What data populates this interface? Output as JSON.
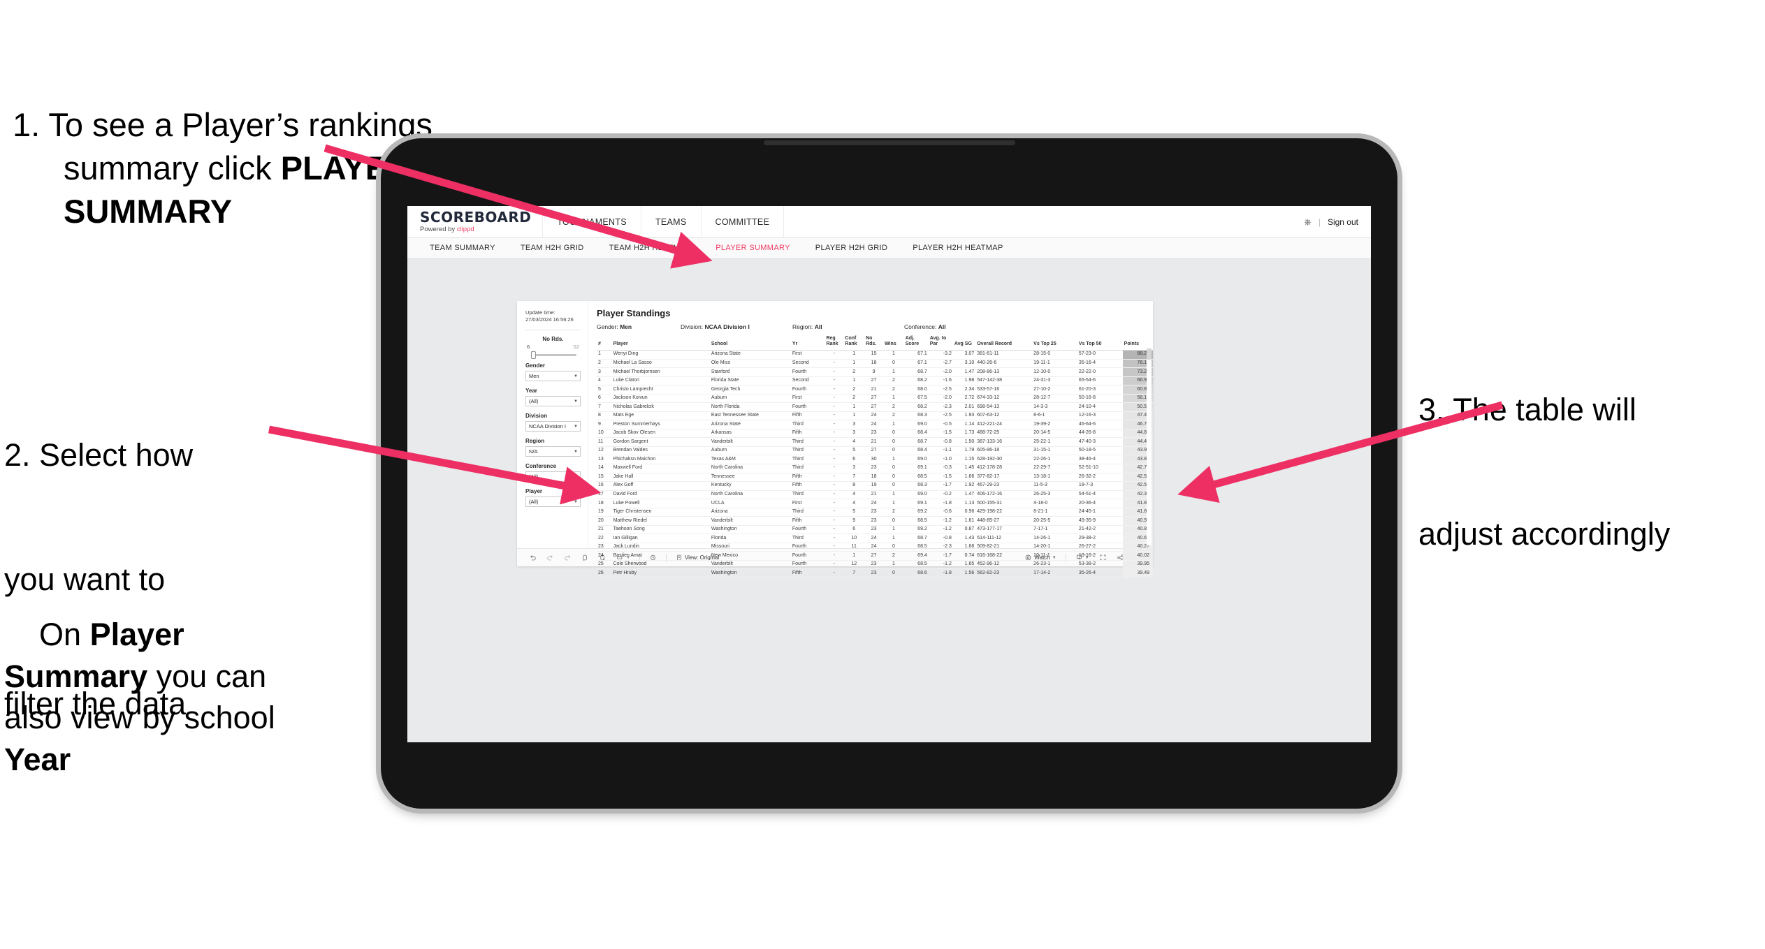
{
  "annotations": {
    "step1_prefix": "1.",
    "step1_part1": " To see a Player’s rankings summary click ",
    "step1_bold": "PLAYER SUMMARY",
    "step2_line1": "2. Select how",
    "step2_line2": "you want to",
    "step2_line3": "filter the data",
    "step2b_pre": "On ",
    "step2b_bold1": "Player Summary",
    "step2b_mid": " you can also view by school ",
    "step2b_bold2": "Year",
    "step3_line1": "3. The table will",
    "step3_line2": "adjust accordingly"
  },
  "app": {
    "brand_name": "SCOREBOARD",
    "brand_sub_prefix": "Powered by ",
    "brand_sub_accent": "clippd",
    "accent_color": "#ee3b63",
    "top_nav": [
      "TOURNAMENTS",
      "TEAMS",
      "COMMITTEE"
    ],
    "account_icon": "person-icon",
    "divider": "|",
    "sign_out": "Sign out"
  },
  "tabs": [
    {
      "label": "TEAM SUMMARY",
      "active": false
    },
    {
      "label": "TEAM H2H GRID",
      "active": false
    },
    {
      "label": "TEAM H2H HEATMAP",
      "active": false
    },
    {
      "label": "PLAYER SUMMARY",
      "active": true
    },
    {
      "label": "PLAYER H2H GRID",
      "active": false
    },
    {
      "label": "PLAYER H2H HEATMAP",
      "active": false
    }
  ],
  "filters": {
    "update_label": "Update time:",
    "update_value": "27/03/2024 16:56:26",
    "slider": {
      "title": "No Rds.",
      "min": "6",
      "max": "52"
    },
    "selects": [
      {
        "label": "Gender",
        "value": "Men"
      },
      {
        "label": "Year",
        "value": "(All)"
      },
      {
        "label": "Division",
        "value": "NCAA Division I"
      },
      {
        "label": "Region",
        "value": "N/A"
      },
      {
        "label": "Conference",
        "value": "(All)"
      },
      {
        "label": "Player",
        "value": "(All)"
      }
    ]
  },
  "viz": {
    "title": "Player Standings",
    "subtitle": [
      {
        "label": "Gender:",
        "value": "Men"
      },
      {
        "label": "Division:",
        "value": "NCAA Division I"
      },
      {
        "label": "Region:",
        "value": "All"
      },
      {
        "label": "Conference:",
        "value": "All"
      }
    ],
    "columns": [
      "#",
      "Player",
      "School",
      "Yr",
      "Reg Rank",
      "Conf Rank",
      "No Rds.",
      "Wins",
      "Adj. Score",
      "Avg. to Par",
      "Avg SG",
      "Overall Record",
      "Vs Top 25",
      "Vs Top 50",
      "Points"
    ],
    "rows": [
      [
        "1",
        "Wenyi Ding",
        "Arizona State",
        "First",
        "-",
        "1",
        "15",
        "1",
        "67.1",
        "-3.2",
        "3.07",
        "381-61-11",
        "28-15-0",
        "57-23-0",
        "88.22"
      ],
      [
        "2",
        "Michael La Sasso",
        "Ole Miss",
        "Second",
        "-",
        "1",
        "18",
        "0",
        "67.1",
        "-2.7",
        "3.10",
        "440-26-6",
        "19-11-1",
        "35-16-4",
        "76.12"
      ],
      [
        "3",
        "Michael Thorbjornsen",
        "Stanford",
        "Fourth",
        "-",
        "2",
        "9",
        "1",
        "68.7",
        "-2.0",
        "1.47",
        "208-86-13",
        "12-10-0",
        "22-22-0",
        "73.22"
      ],
      [
        "4",
        "Luke Claton",
        "Florida State",
        "Second",
        "-",
        "1",
        "27",
        "2",
        "68.2",
        "-1.6",
        "1.98",
        "547-142-38",
        "24-31-3",
        "65-54-6",
        "66.94"
      ],
      [
        "5",
        "Christo Lamprecht",
        "Georgia Tech",
        "Fourth",
        "-",
        "2",
        "21",
        "2",
        "68.0",
        "-2.5",
        "2.34",
        "533-57-16",
        "27-10-2",
        "61-20-3",
        "60.89"
      ],
      [
        "6",
        "Jackson Koivun",
        "Auburn",
        "First",
        "-",
        "2",
        "27",
        "1",
        "67.5",
        "-2.0",
        "2.72",
        "674-33-12",
        "28-12-7",
        "50-16-8",
        "58.18"
      ],
      [
        "7",
        "Nicholas Gabrelcik",
        "North Florida",
        "Fourth",
        "-",
        "1",
        "27",
        "2",
        "68.2",
        "-2.3",
        "2.01",
        "698-54-13",
        "14-3-3",
        "24-10-4",
        "50.56"
      ],
      [
        "8",
        "Mats Ege",
        "East Tennessee State",
        "Fifth",
        "-",
        "1",
        "24",
        "2",
        "68.3",
        "-2.5",
        "1.93",
        "607-63-12",
        "8-6-1",
        "12-16-3",
        "47.42"
      ],
      [
        "9",
        "Preston Summerhays",
        "Arizona State",
        "Third",
        "-",
        "3",
        "24",
        "1",
        "69.0",
        "-0.5",
        "1.14",
        "412-221-24",
        "19-39-2",
        "46-64-6",
        "46.77"
      ],
      [
        "10",
        "Jacob Skov Olesen",
        "Arkansas",
        "Fifth",
        "-",
        "3",
        "23",
        "0",
        "68.4",
        "-1.5",
        "1.73",
        "488-72-25",
        "20-14-5",
        "44-26-8",
        "44.82"
      ],
      [
        "11",
        "Gordon Sargent",
        "Vanderbilt",
        "Third",
        "-",
        "4",
        "21",
        "0",
        "68.7",
        "-0.8",
        "1.50",
        "387-133-16",
        "25-22-1",
        "47-40-3",
        "44.49"
      ],
      [
        "12",
        "Brendan Valdes",
        "Auburn",
        "Third",
        "-",
        "5",
        "27",
        "0",
        "68.4",
        "-1.1",
        "1.79",
        "605-96-18",
        "31-15-1",
        "50-18-5",
        "43.95"
      ],
      [
        "13",
        "Phichaksn Maichon",
        "Texas A&M",
        "Third",
        "-",
        "6",
        "30",
        "1",
        "69.0",
        "-1.0",
        "1.15",
        "628-192-30",
        "22-26-1",
        "38-46-4",
        "43.83"
      ],
      [
        "14",
        "Maxwell Ford",
        "North Carolina",
        "Third",
        "-",
        "3",
        "23",
        "0",
        "69.1",
        "-0.3",
        "1.45",
        "412-178-28",
        "22-29-7",
        "52-51-10",
        "42.75"
      ],
      [
        "15",
        "Jake Hall",
        "Tennessee",
        "Fifth",
        "-",
        "7",
        "18",
        "0",
        "68.5",
        "-1.5",
        "1.66",
        "377-82-17",
        "13-18-1",
        "26-32-2",
        "42.55"
      ],
      [
        "16",
        "Alex Goff",
        "Kentucky",
        "Fifth",
        "-",
        "8",
        "19",
        "0",
        "68.3",
        "-1.7",
        "1.92",
        "467-29-23",
        "11-5-3",
        "18-7-3",
        "42.54"
      ],
      [
        "17",
        "David Ford",
        "North Carolina",
        "Third",
        "-",
        "4",
        "21",
        "1",
        "69.0",
        "-0.2",
        "1.47",
        "406-172-16",
        "26-25-3",
        "54-51-4",
        "42.35"
      ],
      [
        "18",
        "Luke Powell",
        "UCLA",
        "First",
        "-",
        "4",
        "24",
        "1",
        "69.1",
        "-1.8",
        "1.13",
        "500-155-31",
        "4-18-0",
        "20-36-4",
        "41.87"
      ],
      [
        "19",
        "Tiger Christensen",
        "Arizona",
        "Third",
        "-",
        "5",
        "23",
        "2",
        "69.2",
        "-0.6",
        "0.96",
        "429-198-22",
        "8-21-1",
        "24-45-1",
        "41.81"
      ],
      [
        "20",
        "Matthew Riedel",
        "Vanderbilt",
        "Fifth",
        "-",
        "9",
        "23",
        "0",
        "68.5",
        "-1.2",
        "1.61",
        "448-85-27",
        "20-25-5",
        "49-35-9",
        "40.98"
      ],
      [
        "21",
        "Taehoon Song",
        "Washington",
        "Fourth",
        "-",
        "6",
        "23",
        "1",
        "69.2",
        "-1.2",
        "0.87",
        "473-177-17",
        "7-17-1",
        "21-42-2",
        "40.88"
      ],
      [
        "22",
        "Ian Gilligan",
        "Florida",
        "Third",
        "-",
        "10",
        "24",
        "1",
        "68.7",
        "-0.8",
        "1.43",
        "514-111-12",
        "14-26-1",
        "29-38-2",
        "40.68"
      ],
      [
        "23",
        "Jack Lundin",
        "Missouri",
        "Fourth",
        "-",
        "11",
        "24",
        "0",
        "68.5",
        "-2.3",
        "1.68",
        "509-82-21",
        "14-20-1",
        "26-27-2",
        "40.27"
      ],
      [
        "24",
        "Bastien Amat",
        "New Mexico",
        "Fourth",
        "-",
        "1",
        "27",
        "2",
        "69.4",
        "-1.7",
        "0.74",
        "616-168-22",
        "10-11-1",
        "19-16-2",
        "40.02"
      ],
      [
        "25",
        "Cole Sherwood",
        "Vanderbilt",
        "Fourth",
        "-",
        "12",
        "23",
        "1",
        "68.5",
        "-1.2",
        "1.65",
        "452-96-12",
        "26-23-1",
        "53-38-2",
        "39.95"
      ],
      [
        "26",
        "Petr Hruby",
        "Washington",
        "Fifth",
        "-",
        "7",
        "23",
        "0",
        "68.6",
        "-1.8",
        "1.56",
        "562-82-23",
        "17-14-2",
        "35-26-4",
        "39.49"
      ]
    ]
  },
  "toolbar": {
    "icons": [
      "undo-icon",
      "redo-icon",
      "revert-icon",
      "refresh-icon",
      "pause-icon",
      "device-layout-icon",
      "chevron-down-icon",
      "clock-icon"
    ],
    "view_label": "View: Original",
    "watch_label": "Watch",
    "share_label": "Share",
    "download_icon": "download-icon",
    "fullscreen_icon": "fullscreen-icon",
    "share_icon": "share-icon",
    "eye_icon": "eye-icon"
  }
}
